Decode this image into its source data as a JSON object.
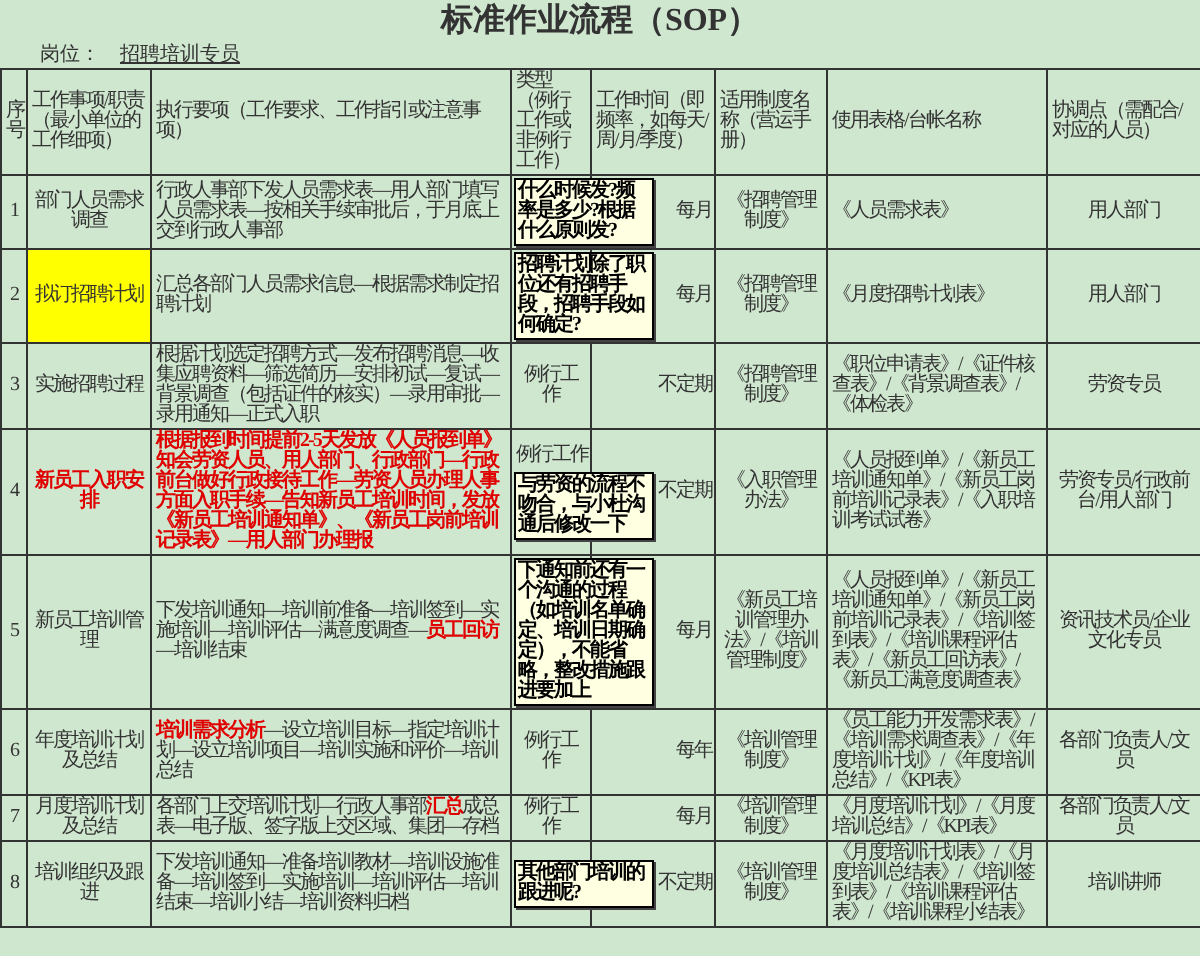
{
  "title": "标准作业流程（SOP）",
  "position": {
    "label": "岗位：",
    "value": "招聘培训专员"
  },
  "columns": [
    "序号",
    "工作事项/职责（最小单位的工作细项）",
    "执行要项（工作要求、工作指引或注意事项）",
    "类型（例行工作或非例行工作）",
    "工作时间（即频率，如每天/周/月/季度）",
    "适用制度名称（营运手册）",
    "使用表格/台帐名称",
    "协调点（需配合/对应的人员）"
  ],
  "rows": [
    {
      "no": "1",
      "task": "部门人员需求调查",
      "highlighted": false,
      "emphasis": false,
      "exec": "行政人事部下发人员需求表—用人部门填写人员需求表—按相关手续审批后，于月底上交到行政人事部",
      "time": "每月",
      "system": "《招聘管理制度》",
      "forms": "《人员需求表》",
      "coord": "用人部门",
      "comment": "什么时候发?频率是多少?根据什么原则发?"
    },
    {
      "no": "2",
      "task": "拟订招聘计划",
      "highlighted": true,
      "emphasis": false,
      "exec": "汇总各部门人员需求信息—根据需求制定招聘计划",
      "time": "每月",
      "system": "《招聘管理制度》",
      "forms": "《月度招聘计划表》",
      "coord": "用人部门",
      "comment": "招聘计划除了职位还有招聘手段，招聘手段如何确定?"
    },
    {
      "no": "3",
      "task": "实施招聘过程",
      "highlighted": false,
      "emphasis": false,
      "exec": "根据计划选定招聘方式—发布招聘消息—收集应聘资料—筛选简历—安排初试—复试—背景调查（包括证件的核实）—录用审批—录用通知—正式入职",
      "type": "例行工作",
      "time": "不定期",
      "system": "《招聘管理制度》",
      "forms": "《职位申请表》/《证件核查表》/《背景调查表》/《体检表》",
      "coord": "劳资专员"
    },
    {
      "no": "4",
      "task": "新员工入职安排",
      "highlighted": false,
      "emphasis": true,
      "exec": "根据报到时间提前2-5天发放《人员报到单》知会劳资人员、用人部门、行政部门—行政前台做好行政接待工作—劳资人员办理人事方面入职手续—告知新员工培训时间，发放《新员工培训通知单》、《新员工岗前培训记录表》—用人部门办理报",
      "type": "例行工作",
      "time": "不定期",
      "system": "《入职管理办法》",
      "forms": "《人员报到单》/《新员工培训通知单》/《新员工岗前培训记录表》/《入职培训考试试卷》",
      "coord": "劳资专员/行政前台/用人部门",
      "comment": "与劳资的流程不吻合，与小杜沟通后修改一下"
    },
    {
      "no": "5",
      "task": "新员工培训管理",
      "highlighted": false,
      "emphasis": false,
      "exec": "下发培训通知—培训前准备—培训签到—实施培训—培训评估—满意度调查—**员工回访**—培训结束",
      "time": "每月",
      "system": "《新员工培训管理办法》/《培训管理制度》",
      "forms": "《人员报到单》/《新员工培训通知单》/《新员工岗前培训记录表》/《培训签到表》/《培训课程评估表》/《新员工回访表》/《新员工满意度调查表》",
      "coord": "资讯技术员/企业文化专员",
      "comment": "下通知前还有一个沟通的过程（如培训名单确定、培训日期确定），不能省略，整改措施跟进要加上"
    },
    {
      "no": "6",
      "task": "年度培训计划及总结",
      "highlighted": false,
      "emphasis": false,
      "exec": "**培训需求分析**—设立培训目标—指定培训计划—设立培训项目—培训实施和评价—培训总结",
      "type": "例行工作",
      "time": "每年",
      "system": "《培训管理制度》",
      "forms": "《员工能力开发需求表》/《培训需求调查表》/《年度培训计划》/《年度培训总结》/《KPI表》",
      "coord": "各部门负责人/文员"
    },
    {
      "no": "7",
      "task": "月度培训计划及总结",
      "highlighted": false,
      "emphasis": false,
      "exec": "各部门上交培训计划—行政人事部**汇总**成总表—电子版、签字版上交区域、集团—存档",
      "type": "例行工作",
      "time": "每月",
      "system": "《培训管理制度》",
      "forms": "《月度培训计划》/《月度培训总结》/《KPI表》",
      "coord": "各部门负责人/文员"
    },
    {
      "no": "8",
      "task": "培训组织及跟进",
      "highlighted": false,
      "emphasis": false,
      "exec": "下发培训通知—准备培训教材—培训设施准备—培训签到—实施培训—培训评估—培训结束—培训小结—培训资料归档",
      "time": "不定期",
      "system": "《培训管理制度》",
      "forms": "《月度培训计划表》/《月度培训总结表》/《培训签到表》/《培训课程评估表》/《培训课程小结表》",
      "coord": "培训讲师",
      "comment": "其他部门培训的跟进呢?"
    }
  ]
}
